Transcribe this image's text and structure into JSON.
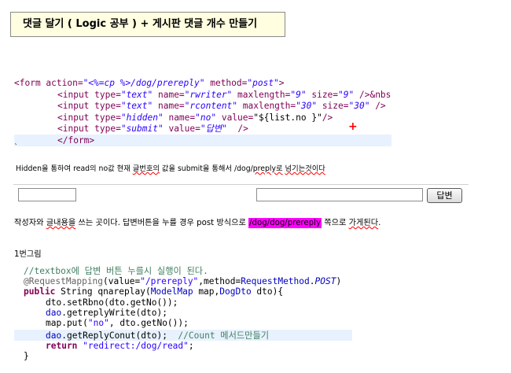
{
  "title": "댓글 달기 ( Logic 공부 ) + 게시판 댓글 개수 만들기",
  "code_form": {
    "line1": {
      "a": "<form action=",
      "b": "\"<%=cp %>/dog/prereply\"",
      "c": " method=",
      "d": "\"post\"",
      "e": ">"
    },
    "line2": {
      "a": "<input type=",
      "b": "\"text\"",
      "c": " name=",
      "d": "\"rwriter\"",
      "e": " maxlength=",
      "f": "\"9\"",
      "g": " size=",
      "h": "\"9\"",
      "i": " />&nbs"
    },
    "line3": {
      "a": "<input type=",
      "b": "\"text\"",
      "c": " name=",
      "d": "\"rcontent\"",
      "e": " maxlength=",
      "f": "\"30\"",
      "g": " size=",
      "h": "\"30\"",
      "i": " />"
    },
    "line4": {
      "a": "<input type=",
      "b": "\"hidden\"",
      "c": " name=",
      "d": "\"no\"",
      "e": " value=",
      "f": "\"${list.no }\"",
      "g": "/>"
    },
    "line5": {
      "a": "<input type=",
      "b": "\"submit\"",
      "c": " value=",
      "d": "\"답변\"",
      "e": "  />"
    },
    "line6": "</form>",
    "plus": "+",
    "end_mark": "`"
  },
  "desc1": {
    "a": "Hidden을 통하여 read의 no값 현재 ",
    "b": "글번호의",
    "c": " 값을  submit을 통해서 /dog/",
    "d": "preply로",
    "e": " ",
    "f": "넘기는것이다"
  },
  "form_preview": {
    "submit_label": "답변",
    "writer_value": "",
    "content_value": ""
  },
  "desc2": {
    "a": "작성자와 ",
    "b": "글내용을",
    "c": " 쓰는 곳이다. 답변버튼을 누를 경우 post 방식으로 ",
    "d": "/dog/dog/prereply",
    "e": " 쪽으로 ",
    "f": "가게된다",
    "g": "."
  },
  "sub_label": "1번그림",
  "code_java": {
    "l1": "//textbox에 답변 버튼 누를시 실행이 된다.",
    "l2": {
      "a": "@RequestMapping",
      "b": "(value=",
      "c": "\"/prereply\"",
      "d": ",method=",
      "e": "RequestMethod",
      "f": ".",
      "g": "POST",
      "h": ")"
    },
    "l3": {
      "a": "public",
      "b": " ",
      "c": "String",
      "d": " qnareplay(",
      "e": "ModelMap",
      "f": " map,",
      "g": "DogDto",
      "h": " dto){"
    },
    "l4": "dto.setRbno(dto.getNo());",
    "l5": {
      "a": "dao",
      "b": ".getreplyWrite(dto);"
    },
    "l6": {
      "a": "map.put(",
      "b": "\"no\"",
      "c": ", dto.getNo());"
    },
    "l7": {
      "a": "dao",
      "b": ".getReplyConut(dto);  ",
      "c": "//Count 메서드만들기"
    },
    "l8": {
      "a": "return",
      "b": " ",
      "c": "\"redirect:/dog/read\"",
      "d": ";"
    },
    "l9": "}"
  }
}
